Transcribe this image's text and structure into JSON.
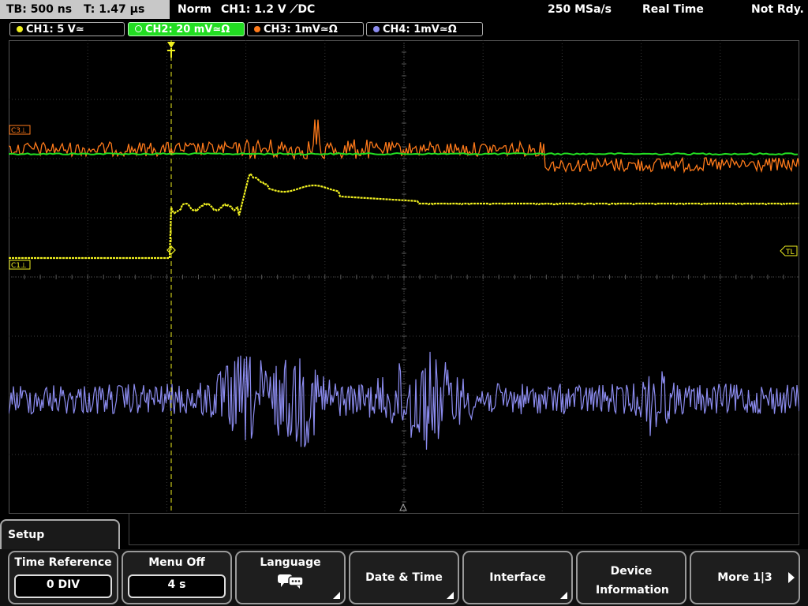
{
  "status": {
    "timebase": "TB: 500 ns",
    "trigger_time": "T: 1.47 µs",
    "mode": "Norm",
    "trigger_setting": "CH1: 1.2 V ⟋DC",
    "sample_rate": "250 MSa/s",
    "acquisition": "Real Time",
    "state": "Not Rdy."
  },
  "channels": [
    {
      "label": "CH1: 5 V≃",
      "color": "#f0f020",
      "active": false
    },
    {
      "label": "CH2: 20 mV≃Ω",
      "color": "#22dd22",
      "active": true
    },
    {
      "label": "CH3: 1mV≃Ω",
      "color": "#ff7a1a",
      "active": false
    },
    {
      "label": "CH4: 1mV≃Ω",
      "color": "#8c8cf0",
      "active": false
    }
  ],
  "markers": {
    "c3": "C3⊥",
    "c1": "C1⊥",
    "trigger_level": "TL"
  },
  "menu": {
    "title": "Setup",
    "softkeys": [
      {
        "label": "Time Reference",
        "value": "0 DIV"
      },
      {
        "label": "Menu Off",
        "value": "4 s"
      },
      {
        "label": "Language",
        "icon": "speech-bubble-icon"
      },
      {
        "label": "Date & Time"
      },
      {
        "label": "Interface"
      },
      {
        "label": "Device Information"
      },
      {
        "label": "More 1|3"
      }
    ]
  }
}
